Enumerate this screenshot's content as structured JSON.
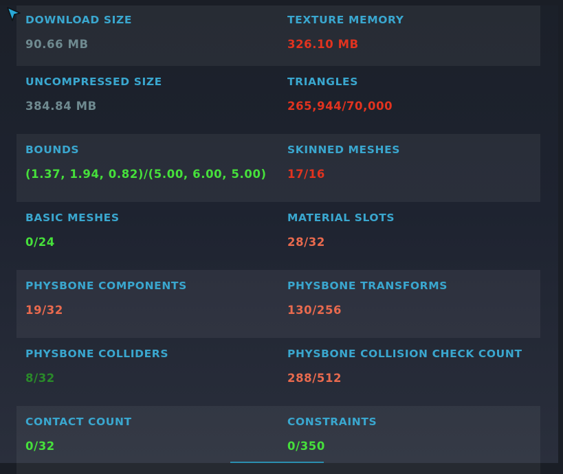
{
  "stats": [
    {
      "left": {
        "label": "DOWNLOAD SIZE",
        "value": "90.66 MB",
        "color": "#6f8a90"
      },
      "right": {
        "label": "TEXTURE MEMORY",
        "value": "326.10 MB",
        "color": "#e2331f"
      }
    },
    {
      "left": {
        "label": "UNCOMPRESSED SIZE",
        "value": "384.84 MB",
        "color": "#6f8a90"
      },
      "right": {
        "label": "TRIANGLES",
        "value": "265,944/70,000",
        "color": "#e2331f"
      }
    },
    {
      "left": {
        "label": "BOUNDS",
        "value": "(1.37, 1.94, 0.82)/(5.00, 6.00, 5.00)",
        "color": "#46e03b"
      },
      "right": {
        "label": "SKINNED MESHES",
        "value": "17/16",
        "color": "#e2331f"
      }
    },
    {
      "left": {
        "label": "BASIC MESHES",
        "value": "0/24",
        "color": "#46e03b"
      },
      "right": {
        "label": "MATERIAL SLOTS",
        "value": "28/32",
        "color": "#e96a4e"
      }
    },
    {
      "left": {
        "label": "PHYSBONE COMPONENTS",
        "value": "19/32",
        "color": "#e96a4e"
      },
      "right": {
        "label": "PHYSBONE TRANSFORMS",
        "value": "130/256",
        "color": "#e96a4e"
      }
    },
    {
      "left": {
        "label": "PHYSBONE COLLIDERS",
        "value": "8/32",
        "color": "#2a8a2a"
      },
      "right": {
        "label": "PHYSBONE COLLISION CHECK COUNT",
        "value": "288/512",
        "color": "#e96a4e"
      }
    },
    {
      "left": {
        "label": "CONTACT COUNT",
        "value": "0/32",
        "color": "#46e03b"
      },
      "right": {
        "label": "CONSTRAINTS",
        "value": "0/350",
        "color": "#46e03b"
      }
    }
  ],
  "theme": {
    "label_color": "#3aa7cf",
    "cursor_color": "#29a8d6"
  },
  "icons": {
    "cursor": "pointer-cursor-icon"
  }
}
